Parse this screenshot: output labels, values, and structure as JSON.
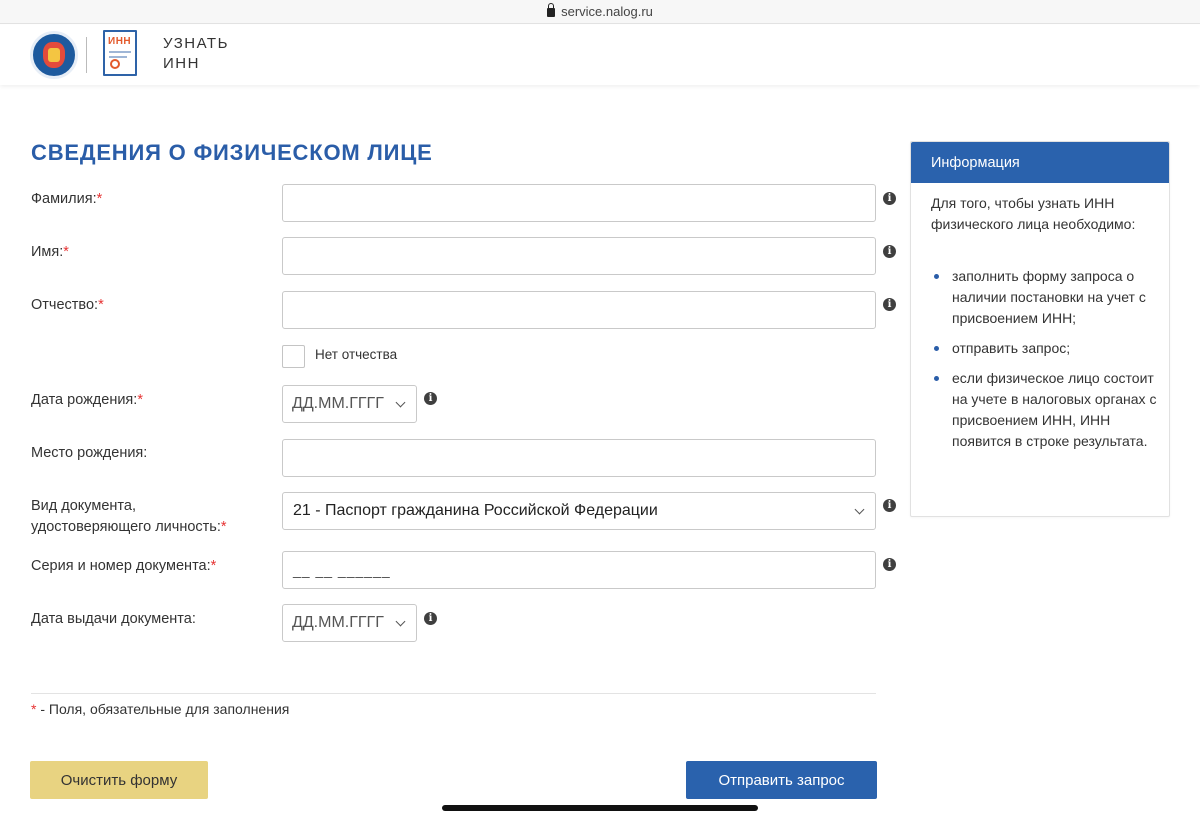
{
  "browser": {
    "url": "service.nalog.ru"
  },
  "header": {
    "brand_line1": "УЗНАТЬ",
    "brand_line2": "ИНН",
    "doc_icon_text": "ИНН"
  },
  "form": {
    "title": "Сведения о физическом лице",
    "fields": {
      "surname": {
        "label": "Фамилия:",
        "required": "*",
        "value": ""
      },
      "name": {
        "label": "Имя:",
        "required": "*",
        "value": ""
      },
      "patronymic": {
        "label": "Отчество:",
        "required": "*",
        "value": ""
      },
      "no_patronymic": {
        "label": "Нет отчества",
        "checked": false
      },
      "birth_date": {
        "label": "Дата рождения:",
        "required": "*",
        "placeholder": "ДД.ММ.ГГГГ"
      },
      "birth_place": {
        "label": "Место рождения:",
        "value": ""
      },
      "doc_type": {
        "label_line1": "Вид документа,",
        "label_line2": "удостоверяющего личность:",
        "required": "*",
        "selected": "21 - Паспорт гражданина Российской Федерации"
      },
      "doc_number": {
        "label": "Серия и номер документа:",
        "required": "*",
        "mask": "__ __ ______"
      },
      "doc_date": {
        "label": "Дата выдачи документа:",
        "placeholder": "ДД.ММ.ГГГГ"
      }
    },
    "required_note_star": "*",
    "required_note": " - Поля, обязательные для заполнения",
    "clear_button": "Очистить форму",
    "submit_button": "Отправить запрос"
  },
  "info_panel": {
    "title": "Информация",
    "intro": "Для того, чтобы узнать ИНН физического лица необходимо:",
    "items": [
      "заполнить форму запроса о наличии постановки на учет с присвоением ИНН;",
      "отправить запрос;",
      "если физическое лицо состоит на учете в налоговых органах с присвоением ИНН, ИНН появится в строке результата."
    ]
  },
  "colors": {
    "accent_blue": "#2a62ad",
    "title_blue": "#2a5da8",
    "clear_button": "#e8d381",
    "required_red": "#e63333"
  },
  "icons": {
    "info": "info-icon",
    "lock": "lock-icon",
    "chevron": "chevron-down-icon"
  }
}
